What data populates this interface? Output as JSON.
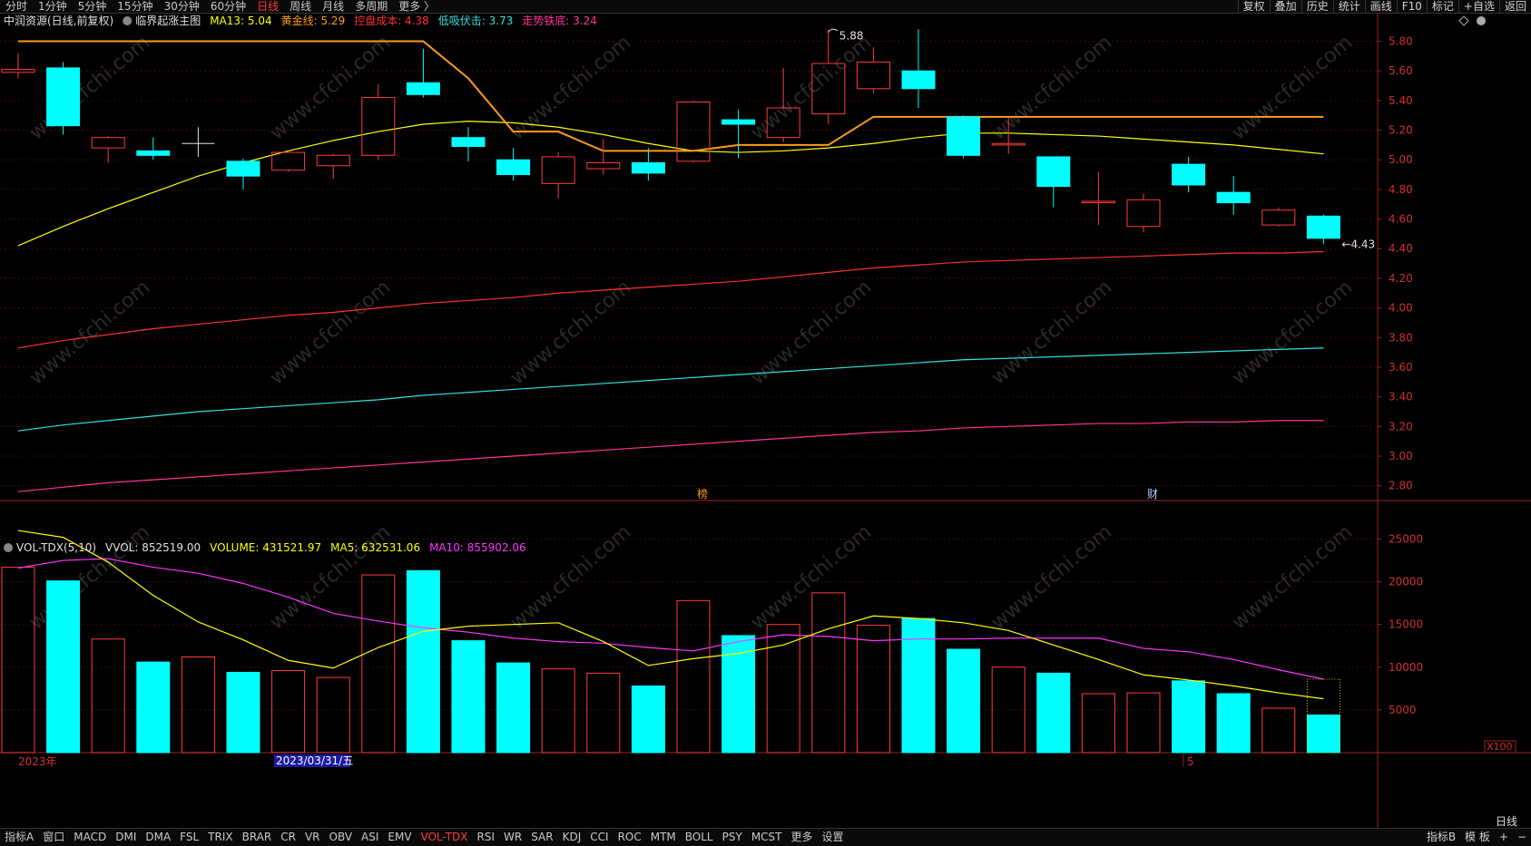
{
  "topbar": {
    "items": [
      "分时",
      "1分钟",
      "5分钟",
      "15分钟",
      "30分钟",
      "60分钟",
      "日线",
      "周线",
      "月线",
      "多周期",
      "更多 〉"
    ],
    "active_index": 6,
    "right_items": [
      "复权",
      "叠加",
      "历史",
      "统计",
      "画线",
      "F10",
      "标记",
      "+自选",
      "返回"
    ]
  },
  "price_header": {
    "stock": "中润资源(日线,前复权)",
    "indicator": "临界起涨主图",
    "items": [
      {
        "label": "MA13: 5.04",
        "color": "#ffff00"
      },
      {
        "label": "黄金线: 5.29",
        "color": "#ff9a1a"
      },
      {
        "label": "控盘成本: 4.38",
        "color": "#ff3030"
      },
      {
        "label": "低吸伏击: 3.73",
        "color": "#33e0e0"
      },
      {
        "label": "走势铁底: 3.24",
        "color": "#ff3399"
      }
    ]
  },
  "vol_header": {
    "name": "VOL-TDX(5,10)",
    "items": [
      {
        "label": "VVOL: 852519.00",
        "color": "#e0e0e0"
      },
      {
        "label": "VOLUME: 431521.97",
        "color": "#ffff00"
      },
      {
        "label": "MA5: 632531.06",
        "color": "#ffff00"
      },
      {
        "label": "MA10: 855902.06",
        "color": "#ff33ff"
      }
    ]
  },
  "annotations": {
    "high_label": "5.88",
    "low_label": "4.43",
    "marker_1": "榜",
    "marker_2": "财",
    "date_start": "2023年",
    "date_cursor": "2023/03/31/五",
    "date_month": "5",
    "period_label": "日线",
    "vol_unit": "X100"
  },
  "colors": {
    "up": "#ff3b3b",
    "down": "#00ffff",
    "ma13": "#ffff00",
    "gold": "#ff9a1a",
    "cost": "#ff3030",
    "ambush": "#33e0e0",
    "bottom": "#ff3399",
    "ma10": "#ff33ff"
  },
  "chart_data": {
    "type": "candlestick",
    "price_axis": {
      "ticks": [
        2.8,
        3.0,
        3.2,
        3.4,
        3.6,
        3.8,
        4.0,
        4.2,
        4.4,
        4.6,
        4.8,
        5.0,
        5.2,
        5.4,
        5.6,
        5.8
      ],
      "ylim": [
        2.7,
        5.95
      ]
    },
    "volume_axis": {
      "ticks": [
        5000,
        10000,
        15000,
        20000,
        25000
      ],
      "ylim": [
        0,
        27600
      ]
    },
    "candles": [
      {
        "o": 5.59,
        "c": 5.61,
        "h": 5.72,
        "l": 5.55,
        "v": 21700,
        "dir": "up"
      },
      {
        "o": 5.62,
        "c": 5.23,
        "h": 5.66,
        "l": 5.17,
        "v": 20100,
        "dir": "down"
      },
      {
        "o": 5.08,
        "c": 5.15,
        "h": 5.16,
        "l": 4.98,
        "v": 13300,
        "dir": "up"
      },
      {
        "o": 5.06,
        "c": 5.03,
        "h": 5.15,
        "l": 5.0,
        "v": 10600,
        "dir": "down"
      },
      {
        "o": 5.11,
        "c": 5.11,
        "h": 5.22,
        "l": 5.02,
        "v": 11200,
        "dir": "up",
        "doji": true
      },
      {
        "o": 4.99,
        "c": 4.89,
        "h": 5.01,
        "l": 4.8,
        "v": 9400,
        "dir": "down"
      },
      {
        "o": 4.93,
        "c": 5.05,
        "h": 5.06,
        "l": 4.92,
        "v": 9600,
        "dir": "up"
      },
      {
        "o": 4.96,
        "c": 5.03,
        "h": 5.04,
        "l": 4.87,
        "v": 8800,
        "dir": "up"
      },
      {
        "o": 5.03,
        "c": 5.42,
        "h": 5.51,
        "l": 5.0,
        "v": 20800,
        "dir": "up"
      },
      {
        "o": 5.52,
        "c": 5.44,
        "h": 5.75,
        "l": 5.42,
        "v": 21300,
        "dir": "down"
      },
      {
        "o": 5.15,
        "c": 5.09,
        "h": 5.22,
        "l": 4.99,
        "v": 13100,
        "dir": "down"
      },
      {
        "o": 5.0,
        "c": 4.9,
        "h": 5.08,
        "l": 4.86,
        "v": 10500,
        "dir": "down"
      },
      {
        "o": 4.84,
        "c": 5.02,
        "h": 5.05,
        "l": 4.74,
        "v": 9800,
        "dir": "up"
      },
      {
        "o": 4.94,
        "c": 4.98,
        "h": 5.14,
        "l": 4.9,
        "v": 9300,
        "dir": "up"
      },
      {
        "o": 4.98,
        "c": 4.91,
        "h": 5.08,
        "l": 4.86,
        "v": 7800,
        "dir": "down"
      },
      {
        "o": 4.99,
        "c": 5.39,
        "h": 5.4,
        "l": 4.98,
        "v": 17800,
        "dir": "up"
      },
      {
        "o": 5.27,
        "c": 5.24,
        "h": 5.34,
        "l": 5.01,
        "v": 13700,
        "dir": "down"
      },
      {
        "o": 5.15,
        "c": 5.35,
        "h": 5.62,
        "l": 5.12,
        "v": 15000,
        "dir": "up"
      },
      {
        "o": 5.31,
        "c": 5.65,
        "h": 5.88,
        "l": 5.24,
        "v": 18700,
        "dir": "up"
      },
      {
        "o": 5.48,
        "c": 5.66,
        "h": 5.76,
        "l": 5.45,
        "v": 14900,
        "dir": "up"
      },
      {
        "o": 5.6,
        "c": 5.48,
        "h": 5.88,
        "l": 5.35,
        "v": 15700,
        "dir": "down"
      },
      {
        "o": 5.29,
        "c": 5.03,
        "h": 5.3,
        "l": 5.01,
        "v": 12100,
        "dir": "down"
      },
      {
        "o": 5.1,
        "c": 5.11,
        "h": 5.28,
        "l": 5.04,
        "v": 10000,
        "dir": "up"
      },
      {
        "o": 5.02,
        "c": 4.82,
        "h": 5.02,
        "l": 4.68,
        "v": 9300,
        "dir": "down"
      },
      {
        "o": 4.71,
        "c": 4.72,
        "h": 4.92,
        "l": 4.56,
        "v": 6900,
        "dir": "up"
      },
      {
        "o": 4.55,
        "c": 4.73,
        "h": 4.77,
        "l": 4.51,
        "v": 7000,
        "dir": "up"
      },
      {
        "o": 4.97,
        "c": 4.83,
        "h": 5.02,
        "l": 4.78,
        "v": 8400,
        "dir": "down"
      },
      {
        "o": 4.78,
        "c": 4.71,
        "h": 4.89,
        "l": 4.63,
        "v": 6900,
        "dir": "down"
      },
      {
        "o": 4.56,
        "c": 4.66,
        "h": 4.68,
        "l": 4.55,
        "v": 5200,
        "dir": "up"
      },
      {
        "o": 4.62,
        "c": 4.47,
        "h": 4.63,
        "l": 4.43,
        "v": 4400,
        "dir": "down"
      }
    ],
    "ma13": [
      4.42,
      4.55,
      4.67,
      4.78,
      4.89,
      4.98,
      5.06,
      5.13,
      5.19,
      5.24,
      5.26,
      5.25,
      5.22,
      5.17,
      5.11,
      5.06,
      5.05,
      5.06,
      5.08,
      5.11,
      5.15,
      5.18,
      5.18,
      5.17,
      5.16,
      5.14,
      5.12,
      5.1,
      5.07,
      5.04
    ],
    "gold": [
      5.8,
      5.8,
      5.8,
      5.8,
      5.8,
      5.8,
      5.8,
      5.8,
      5.8,
      5.8,
      5.55,
      5.19,
      5.19,
      5.06,
      5.06,
      5.06,
      5.1,
      5.1,
      5.1,
      5.29,
      5.29,
      5.29,
      5.29,
      5.29,
      5.29,
      5.29,
      5.29,
      5.29,
      5.29,
      5.29
    ],
    "cost": [
      3.73,
      3.78,
      3.82,
      3.86,
      3.89,
      3.92,
      3.95,
      3.97,
      4.0,
      4.03,
      4.05,
      4.07,
      4.1,
      4.12,
      4.14,
      4.16,
      4.18,
      4.21,
      4.24,
      4.27,
      4.29,
      4.31,
      4.32,
      4.33,
      4.34,
      4.35,
      4.36,
      4.37,
      4.37,
      4.38
    ],
    "ambush": [
      3.17,
      3.21,
      3.24,
      3.27,
      3.3,
      3.32,
      3.34,
      3.36,
      3.38,
      3.41,
      3.43,
      3.45,
      3.47,
      3.49,
      3.51,
      3.53,
      3.55,
      3.57,
      3.59,
      3.61,
      3.63,
      3.65,
      3.66,
      3.67,
      3.68,
      3.69,
      3.7,
      3.71,
      3.72,
      3.73
    ],
    "bottom": [
      2.76,
      2.79,
      2.82,
      2.84,
      2.86,
      2.88,
      2.9,
      2.92,
      2.94,
      2.96,
      2.98,
      3.0,
      3.02,
      3.04,
      3.06,
      3.08,
      3.1,
      3.12,
      3.14,
      3.16,
      3.17,
      3.19,
      3.2,
      3.21,
      3.22,
      3.22,
      3.23,
      3.23,
      3.24,
      3.24
    ],
    "vol_ma5": [
      26000,
      25200,
      22300,
      18400,
      15300,
      13200,
      10800,
      9900,
      12300,
      14200,
      14800,
      15000,
      15200,
      13000,
      10200,
      11000,
      11600,
      12600,
      14500,
      16000,
      15700,
      15200,
      14300,
      12600,
      10900,
      9100,
      8500,
      7800,
      7000,
      6300
    ],
    "vol_ma10": [
      21600,
      22500,
      22700,
      21700,
      21000,
      19800,
      18200,
      16300,
      15400,
      14600,
      14100,
      13400,
      13000,
      12800,
      12300,
      11900,
      13000,
      13800,
      13600,
      13100,
      13300,
      13300,
      13400,
      13400,
      13400,
      12200,
      11800,
      10900,
      9700,
      8600
    ]
  }
}
